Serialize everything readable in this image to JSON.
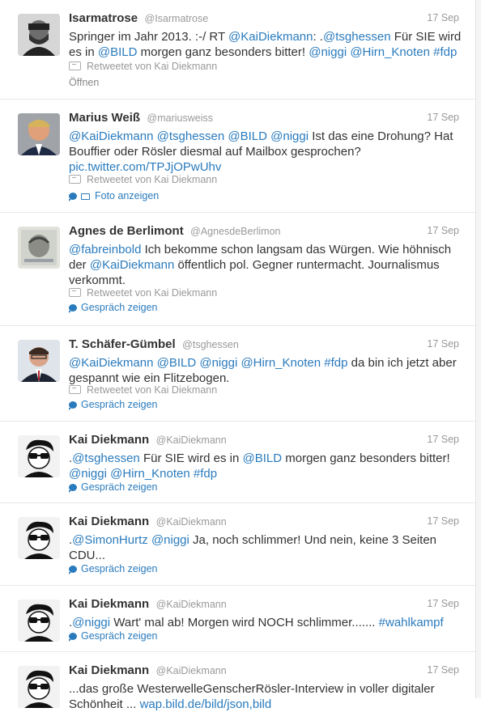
{
  "tweets": [
    {
      "fullname": "Isarmatrose",
      "username": "@Isarmatrose",
      "time": "17 Sep",
      "line1": [
        {
          "t": "Springer im Jahr 2013. :-/ RT ",
          "l": false
        },
        {
          "t": "@KaiDiekmann",
          "l": true
        },
        {
          "t": ": .",
          "l": false
        },
        {
          "t": "@tsghessen",
          "l": true
        },
        {
          "t": " Für SIE wird",
          "l": false
        }
      ],
      "line2": [
        {
          "t": "es in ",
          "l": false
        },
        {
          "t": "@BILD",
          "l": true
        },
        {
          "t": " morgen ganz besonders bitter! ",
          "l": false
        },
        {
          "t": "@niggi",
          "l": true
        },
        {
          "t": " ",
          "l": false
        },
        {
          "t": "@Hirn_Knoten",
          "l": true
        },
        {
          "t": " ",
          "l": false
        },
        {
          "t": "#fdp",
          "l": true
        }
      ],
      "retweeted_by": "Retweetet von Kai Diekmann",
      "action": "Öffnen"
    },
    {
      "fullname": "Marius Weiß",
      "username": "@mariusweiss",
      "time": "17 Sep",
      "line1": [
        {
          "t": "@KaiDiekmann",
          "l": true
        },
        {
          "t": " ",
          "l": false
        },
        {
          "t": "@tsghessen",
          "l": true
        },
        {
          "t": " ",
          "l": false
        },
        {
          "t": "@BILD",
          "l": true
        },
        {
          "t": " ",
          "l": false
        },
        {
          "t": "@niggi",
          "l": true
        },
        {
          "t": " Ist das eine Drohung? Hat",
          "l": false
        }
      ],
      "line2": [
        {
          "t": "Bouffier oder Rösler diesmal auf Mailbox gesprochen?",
          "l": false
        }
      ],
      "line3": [
        {
          "t": "pic.twitter.com/TPJjOPwUhv",
          "l": true
        }
      ],
      "retweeted_by": "Retweetet von Kai Diekmann",
      "action": "Foto anzeigen"
    },
    {
      "fullname": "Agnes de Berlimont",
      "username": "@AgnesdeBerlimon",
      "time": "17 Sep",
      "line1": [
        {
          "t": "@fabreinbold",
          "l": true
        },
        {
          "t": "  Ich bekomme schon langsam das Würgen. Wie höhnisch",
          "l": false
        }
      ],
      "line2": [
        {
          "t": "der ",
          "l": false
        },
        {
          "t": "@KaiDiekmann",
          "l": true
        },
        {
          "t": " öffentlich pol. Gegner runtermacht. Journalismus",
          "l": false
        }
      ],
      "line3": [
        {
          "t": "verkommt.",
          "l": false
        }
      ],
      "retweeted_by": "Retweetet von Kai Diekmann",
      "action": "Gespräch zeigen"
    },
    {
      "fullname": "T. Schäfer-Gümbel",
      "username": "@tsghessen",
      "time": "17 Sep",
      "line1": [
        {
          "t": "@KaiDiekmann",
          "l": true
        },
        {
          "t": " ",
          "l": false
        },
        {
          "t": "@BILD",
          "l": true
        },
        {
          "t": " ",
          "l": false
        },
        {
          "t": "@niggi",
          "l": true
        },
        {
          "t": " ",
          "l": false
        },
        {
          "t": "@Hirn_Knoten",
          "l": true
        },
        {
          "t": " ",
          "l": false
        },
        {
          "t": "#fdp",
          "l": true
        },
        {
          "t": " da bin ich jetzt aber",
          "l": false
        }
      ],
      "line2": [
        {
          "t": "gespannt wie ein Flitzebogen.",
          "l": false
        }
      ],
      "retweeted_by": "Retweetet von Kai Diekmann",
      "action": "Gespräch zeigen"
    },
    {
      "fullname": "Kai Diekmann",
      "username": "@KaiDiekmann",
      "time": "17 Sep",
      "line1": [
        {
          "t": ".",
          "l": false
        },
        {
          "t": "@tsghessen",
          "l": true
        },
        {
          "t": " Für SIE wird es in ",
          "l": false
        },
        {
          "t": "@BILD",
          "l": true
        },
        {
          "t": " morgen ganz besonders bitter!",
          "l": false
        }
      ],
      "line2": [
        {
          "t": "@niggi",
          "l": true
        },
        {
          "t": " ",
          "l": false
        },
        {
          "t": "@Hirn_Knoten",
          "l": true
        },
        {
          "t": " ",
          "l": false
        },
        {
          "t": "#fdp",
          "l": true
        }
      ],
      "action": "Gespräch zeigen"
    },
    {
      "fullname": "Kai Diekmann",
      "username": "@KaiDiekmann",
      "time": "17 Sep",
      "line1": [
        {
          "t": ".",
          "l": false
        },
        {
          "t": "@SimonHurtz",
          "l": true
        },
        {
          "t": " ",
          "l": false
        },
        {
          "t": "@niggi",
          "l": true
        },
        {
          "t": " Ja, noch schlimmer! Und nein, keine 3 Seiten",
          "l": false
        }
      ],
      "line2": [
        {
          "t": "CDU...",
          "l": false
        }
      ],
      "action": "Gespräch zeigen"
    },
    {
      "fullname": "Kai Diekmann",
      "username": "@KaiDiekmann",
      "time": "17 Sep",
      "line1": [
        {
          "t": ".",
          "l": false
        },
        {
          "t": "@niggi",
          "l": true
        },
        {
          "t": " Wart' mal ab! Morgen wird NOCH schlimmer....... ",
          "l": false
        },
        {
          "t": "#wahlkampf",
          "l": true
        }
      ],
      "action": "Gespräch zeigen"
    },
    {
      "fullname": "Kai Diekmann",
      "username": "@KaiDiekmann",
      "time": "17 Sep",
      "line1": [
        {
          "t": "...das große WesterwelleGenscherRösler-Interview in voller digitaler",
          "l": false
        }
      ],
      "line2": [
        {
          "t": "Schönheit ... ",
          "l": false
        },
        {
          "t": "wap.bild.de/bild/json,bild",
          "l": true
        }
      ]
    }
  ]
}
